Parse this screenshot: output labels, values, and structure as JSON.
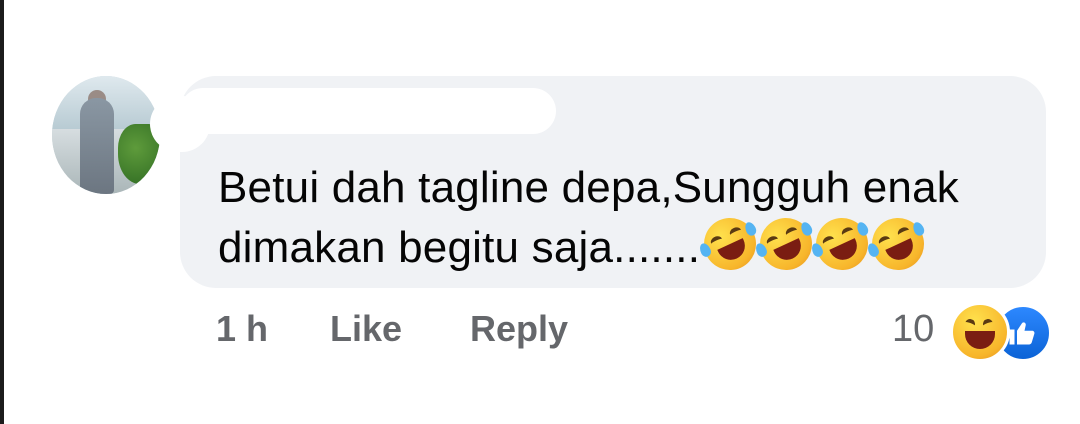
{
  "comment": {
    "text": "Betui dah tagline depa,Sungguh enak dimakan begitu saja.......",
    "inline_emojis": [
      "rolling-on-floor-laughing",
      "rolling-on-floor-laughing",
      "rolling-on-floor-laughing",
      "rolling-on-floor-laughing"
    ]
  },
  "meta": {
    "time": "1 h",
    "like_label": "Like",
    "reply_label": "Reply"
  },
  "reactions": {
    "count": "10",
    "icons": [
      "haha-icon",
      "like-icon"
    ]
  },
  "colors": {
    "bubble": "#f0f2f5",
    "meta_text": "#65676b",
    "like_blue": "#1877f2"
  }
}
